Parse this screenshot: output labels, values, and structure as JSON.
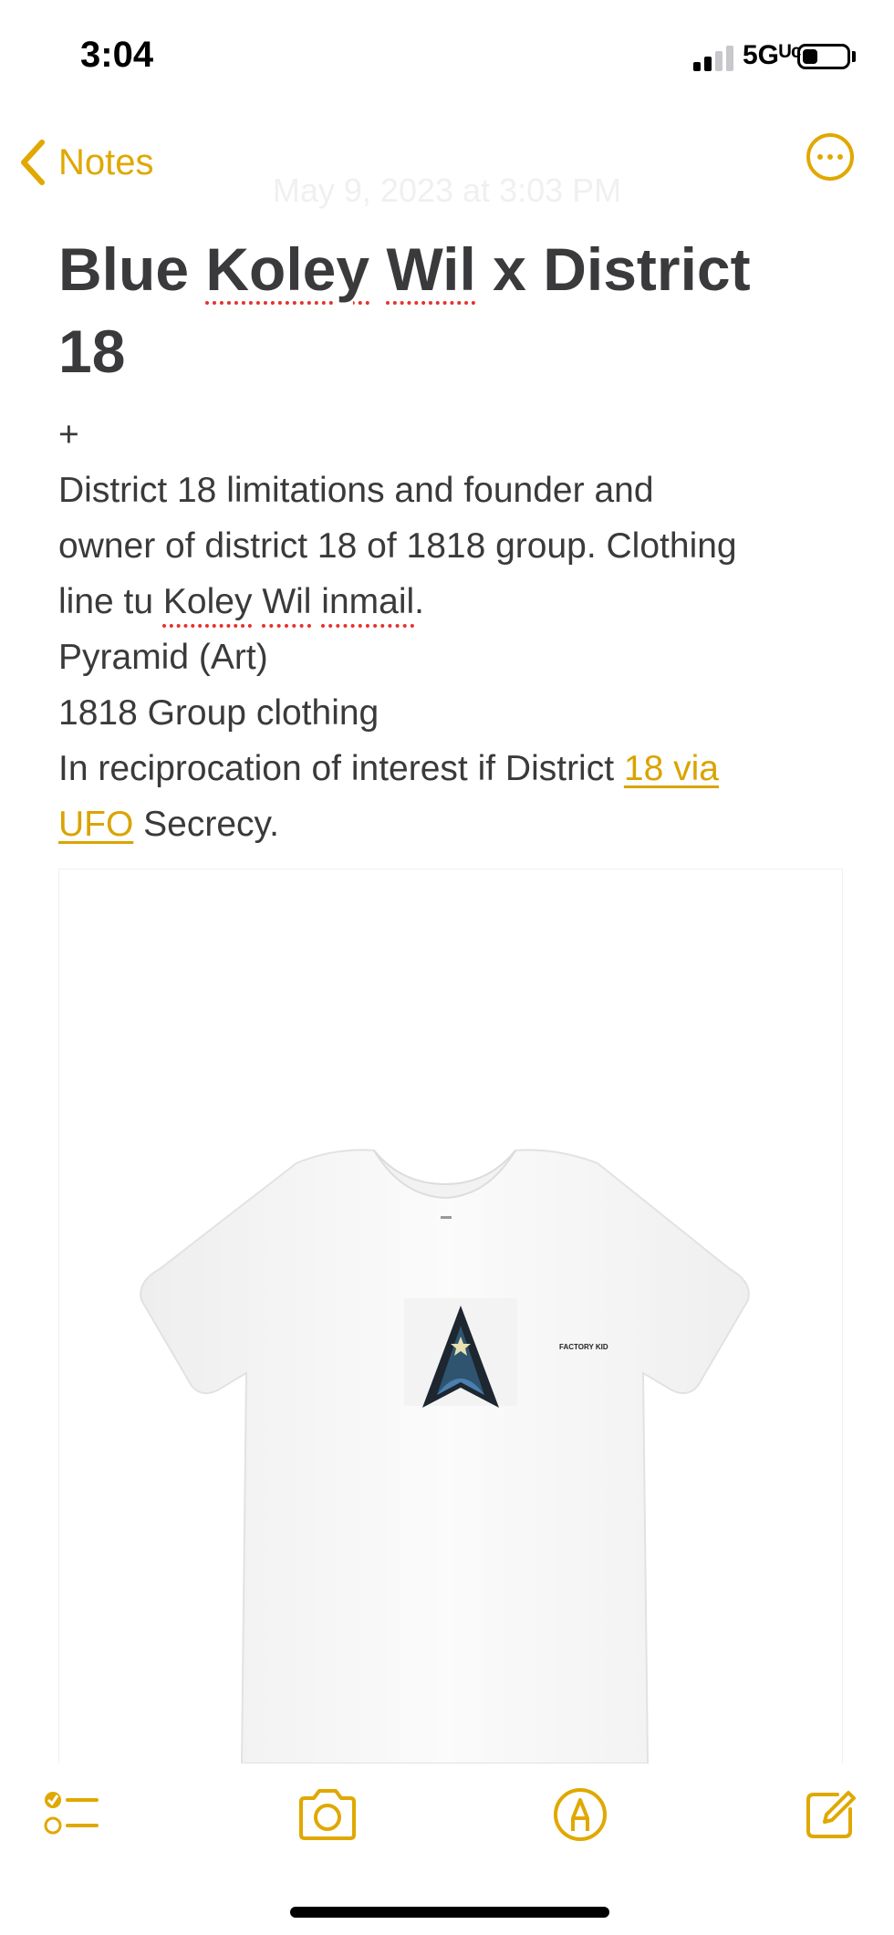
{
  "status_bar": {
    "time": "3:04",
    "network": "5Gᵁᶜ"
  },
  "nav": {
    "back_label": "Notes",
    "date": "May 9, 2023 at 3:03 PM"
  },
  "note": {
    "title_line1_before": "Blue ",
    "title_word_koley": "Koley",
    "title_space": " ",
    "title_word_wil": "Wil",
    "title_line1_after": " x District",
    "title_line2": "18",
    "body": {
      "plus": "+",
      "l2": "District 18 limitations and founder and",
      "l3": "owner of district 18 of 1818 group. Clothing",
      "l4_before": "line tu ",
      "l4_koley": "Koley",
      "l4_space1": " ",
      "l4_wil": "Wil",
      "l4_space2": " ",
      "l4_inmail": "inmail",
      "l4_after": ".",
      "l5": "Pyramid (Art)",
      "l6": "1818 Group clothing",
      "l7_before": "In reciprocation of interest if District ",
      "l7_link": "18 via",
      "l8_link": "UFO",
      "l8_after": " Secrecy."
    }
  },
  "attachment": {
    "shirt_print_text": "FACTORY KID"
  },
  "colors": {
    "accent": "#e0a800",
    "text": "#3a3a3c",
    "spell_underline": "#e5322d"
  },
  "toolbar": {
    "icons": [
      "checklist-icon",
      "camera-icon",
      "markup-icon",
      "compose-icon"
    ]
  }
}
